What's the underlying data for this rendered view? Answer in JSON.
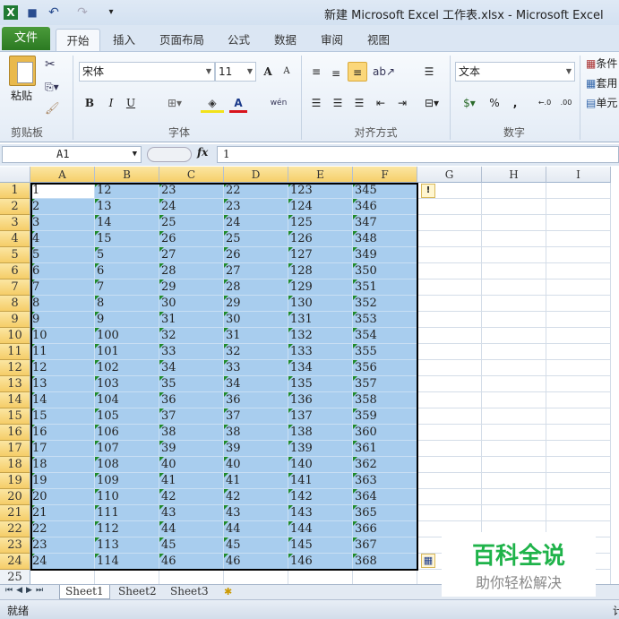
{
  "window": {
    "title": "新建 Microsoft Excel 工作表.xlsx  -  Microsoft Excel"
  },
  "quick_access": {
    "excel_icon": "X",
    "save": "💾",
    "undo": "↶",
    "redo": "↷",
    "customize": "▾"
  },
  "tabs": {
    "file": "文件",
    "items": [
      "开始",
      "插入",
      "页面布局",
      "公式",
      "数据",
      "审阅",
      "视图"
    ]
  },
  "ribbon": {
    "clipboard": {
      "label": "剪贴板",
      "paste": "粘贴"
    },
    "font": {
      "label": "字体",
      "font_name": "宋体",
      "font_size": "11",
      "bold": "B",
      "italic": "I",
      "underline": "U",
      "grow": "A˄",
      "shrink": "A˅",
      "phonetic": "wén"
    },
    "alignment": {
      "label": "对齐方式"
    },
    "number": {
      "label": "数字",
      "format": "文本",
      "percent": "%",
      "comma": ",",
      "inc_decimal": "←.0",
      "dec_decimal": ".00"
    },
    "styles": {
      "conditional": "条件",
      "table": "套用",
      "cell": "单元"
    }
  },
  "formula_bar": {
    "name_box": "A1",
    "fx": "fx",
    "value": "1"
  },
  "columns": [
    "A",
    "B",
    "C",
    "D",
    "E",
    "F",
    "G",
    "H",
    "I"
  ],
  "selected_columns": 6,
  "rows": [
    [
      "1",
      "12",
      "23",
      "22",
      "123",
      "345"
    ],
    [
      "2",
      "13",
      "24",
      "23",
      "124",
      "346"
    ],
    [
      "3",
      "14",
      "25",
      "24",
      "125",
      "347"
    ],
    [
      "4",
      "15",
      "26",
      "25",
      "126",
      "348"
    ],
    [
      "5",
      "5",
      "27",
      "26",
      "127",
      "349"
    ],
    [
      "6",
      "6",
      "28",
      "27",
      "128",
      "350"
    ],
    [
      "7",
      "7",
      "29",
      "28",
      "129",
      "351"
    ],
    [
      "8",
      "8",
      "30",
      "29",
      "130",
      "352"
    ],
    [
      "9",
      "9",
      "31",
      "30",
      "131",
      "353"
    ],
    [
      "10",
      "100",
      "32",
      "31",
      "132",
      "354"
    ],
    [
      "11",
      "101",
      "33",
      "32",
      "133",
      "355"
    ],
    [
      "12",
      "102",
      "34",
      "33",
      "134",
      "356"
    ],
    [
      "13",
      "103",
      "35",
      "34",
      "135",
      "357"
    ],
    [
      "14",
      "104",
      "36",
      "36",
      "136",
      "358"
    ],
    [
      "15",
      "105",
      "37",
      "37",
      "137",
      "359"
    ],
    [
      "16",
      "106",
      "38",
      "38",
      "138",
      "360"
    ],
    [
      "17",
      "107",
      "39",
      "39",
      "139",
      "361"
    ],
    [
      "18",
      "108",
      "40",
      "40",
      "140",
      "362"
    ],
    [
      "19",
      "109",
      "41",
      "41",
      "141",
      "363"
    ],
    [
      "20",
      "110",
      "42",
      "42",
      "142",
      "364"
    ],
    [
      "21",
      "111",
      "43",
      "43",
      "143",
      "365"
    ],
    [
      "22",
      "112",
      "44",
      "44",
      "144",
      "366"
    ],
    [
      "23",
      "113",
      "45",
      "45",
      "145",
      "367"
    ],
    [
      "24",
      "114",
      "46",
      "46",
      "146",
      "368"
    ]
  ],
  "extra_row": "25",
  "sheets": [
    "Sheet1",
    "Sheet2",
    "Sheet3"
  ],
  "status": {
    "ready": "就绪",
    "right": "计"
  },
  "watermark": {
    "title": "百科全说",
    "subtitle": "助你轻松解决"
  }
}
